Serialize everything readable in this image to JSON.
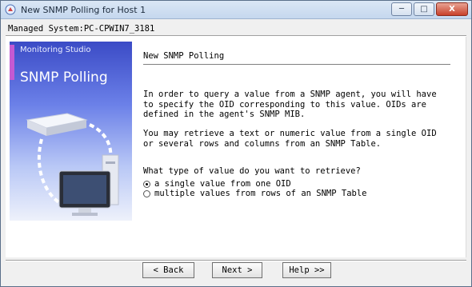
{
  "window": {
    "title": "New SNMP Polling for Host 1",
    "controls": {
      "minimize": "─",
      "maximize": "□",
      "close": "X"
    }
  },
  "header": {
    "managed_system": "Managed System:PC-CPWIN7_3181"
  },
  "banner": {
    "brand": "Monitoring Studio",
    "title": "SNMP Polling"
  },
  "section": {
    "title": "New SNMP Polling"
  },
  "paragraphs": {
    "p1": "In order to query a value from a SNMP agent, you will have\nto specify the OID corresponding to this value. OIDs are\ndefined in the agent's SNMP MIB.",
    "p2": "You may retrieve a text or numeric value from a single OID\nor several rows and columns from an SNMP Table."
  },
  "question": "What type of value do you want to retrieve?",
  "options": [
    {
      "label": "a single value from one OID",
      "selected": true
    },
    {
      "label": "multiple values from rows of an SNMP Table",
      "selected": false
    }
  ],
  "buttons": {
    "back": "< Back",
    "next": "Next >",
    "help": "Help >>"
  }
}
